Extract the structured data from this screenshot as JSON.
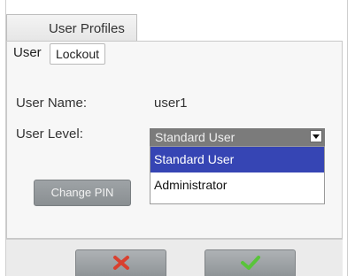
{
  "header": {
    "title": "User Profiles"
  },
  "user_bar": {
    "label": "User",
    "lockout_label": "Lockout"
  },
  "form": {
    "username_label": "User Name:",
    "username_value": "user1",
    "userlevel_label": "User Level:",
    "userlevel_selected": "Standard User",
    "userlevel_options": [
      "Standard User",
      "Administrator"
    ]
  },
  "actions": {
    "change_pin_label": "Change PIN"
  },
  "footer": {
    "cancel_icon": "x-icon",
    "confirm_icon": "check-icon"
  },
  "colors": {
    "selection": "#3645b4",
    "select_background": "#7b7b7b",
    "cancel": "#d9402f",
    "confirm": "#59c43a"
  }
}
